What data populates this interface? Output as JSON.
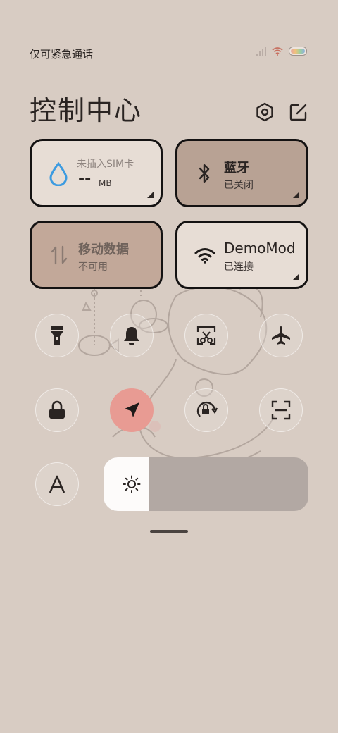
{
  "status_bar": {
    "carrier_text": "仅可紧急通话",
    "icons": [
      "signal-icon",
      "wifi-icon",
      "battery-icon"
    ]
  },
  "header": {
    "title": "控制中心",
    "icons": [
      "settings-icon",
      "edit-icon"
    ]
  },
  "tiles": {
    "data_usage": {
      "line1": "未插入SIM卡",
      "value": "--",
      "unit": "MB"
    },
    "bluetooth": {
      "label": "蓝牙",
      "status": "已关闭"
    },
    "mobile_data": {
      "label": "移动数据",
      "status": "不可用"
    },
    "wifi": {
      "label": "DemoMod",
      "status": "已连接"
    }
  },
  "toggles": [
    "flashlight-icon",
    "bell-icon",
    "screenshot-icon",
    "airplane-icon",
    "lock-icon",
    "location-icon",
    "rotation-lock-icon",
    "scan-icon",
    "font-icon"
  ],
  "toggle_state": {
    "location": "on"
  },
  "brightness": {
    "level": 0.22
  },
  "colors": {
    "background": "#d8ccc3",
    "active_toggle": "#e89b93",
    "tile_dark": "#b8a294"
  }
}
